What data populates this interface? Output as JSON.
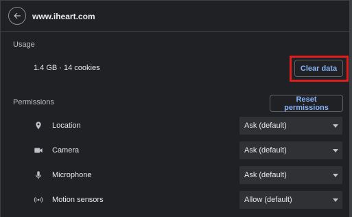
{
  "header": {
    "site": "www.iheart.com",
    "back_icon": "back-arrow-icon"
  },
  "usage": {
    "label": "Usage",
    "summary": "1.4 GB · 14 cookies",
    "clear_button": "Clear data"
  },
  "permissions": {
    "label": "Permissions",
    "reset_button": "Reset permissions",
    "items": [
      {
        "label": "Location",
        "icon": "location-pin-icon",
        "value": "Ask (default)"
      },
      {
        "label": "Camera",
        "icon": "camera-icon",
        "value": "Ask (default)"
      },
      {
        "label": "Microphone",
        "icon": "microphone-icon",
        "value": "Ask (default)"
      },
      {
        "label": "Motion sensors",
        "icon": "motion-sensors-icon",
        "value": "Allow (default)"
      }
    ]
  },
  "colors": {
    "background": "#202124",
    "accent": "#8ab4f8",
    "highlight": "#e01e1e"
  }
}
